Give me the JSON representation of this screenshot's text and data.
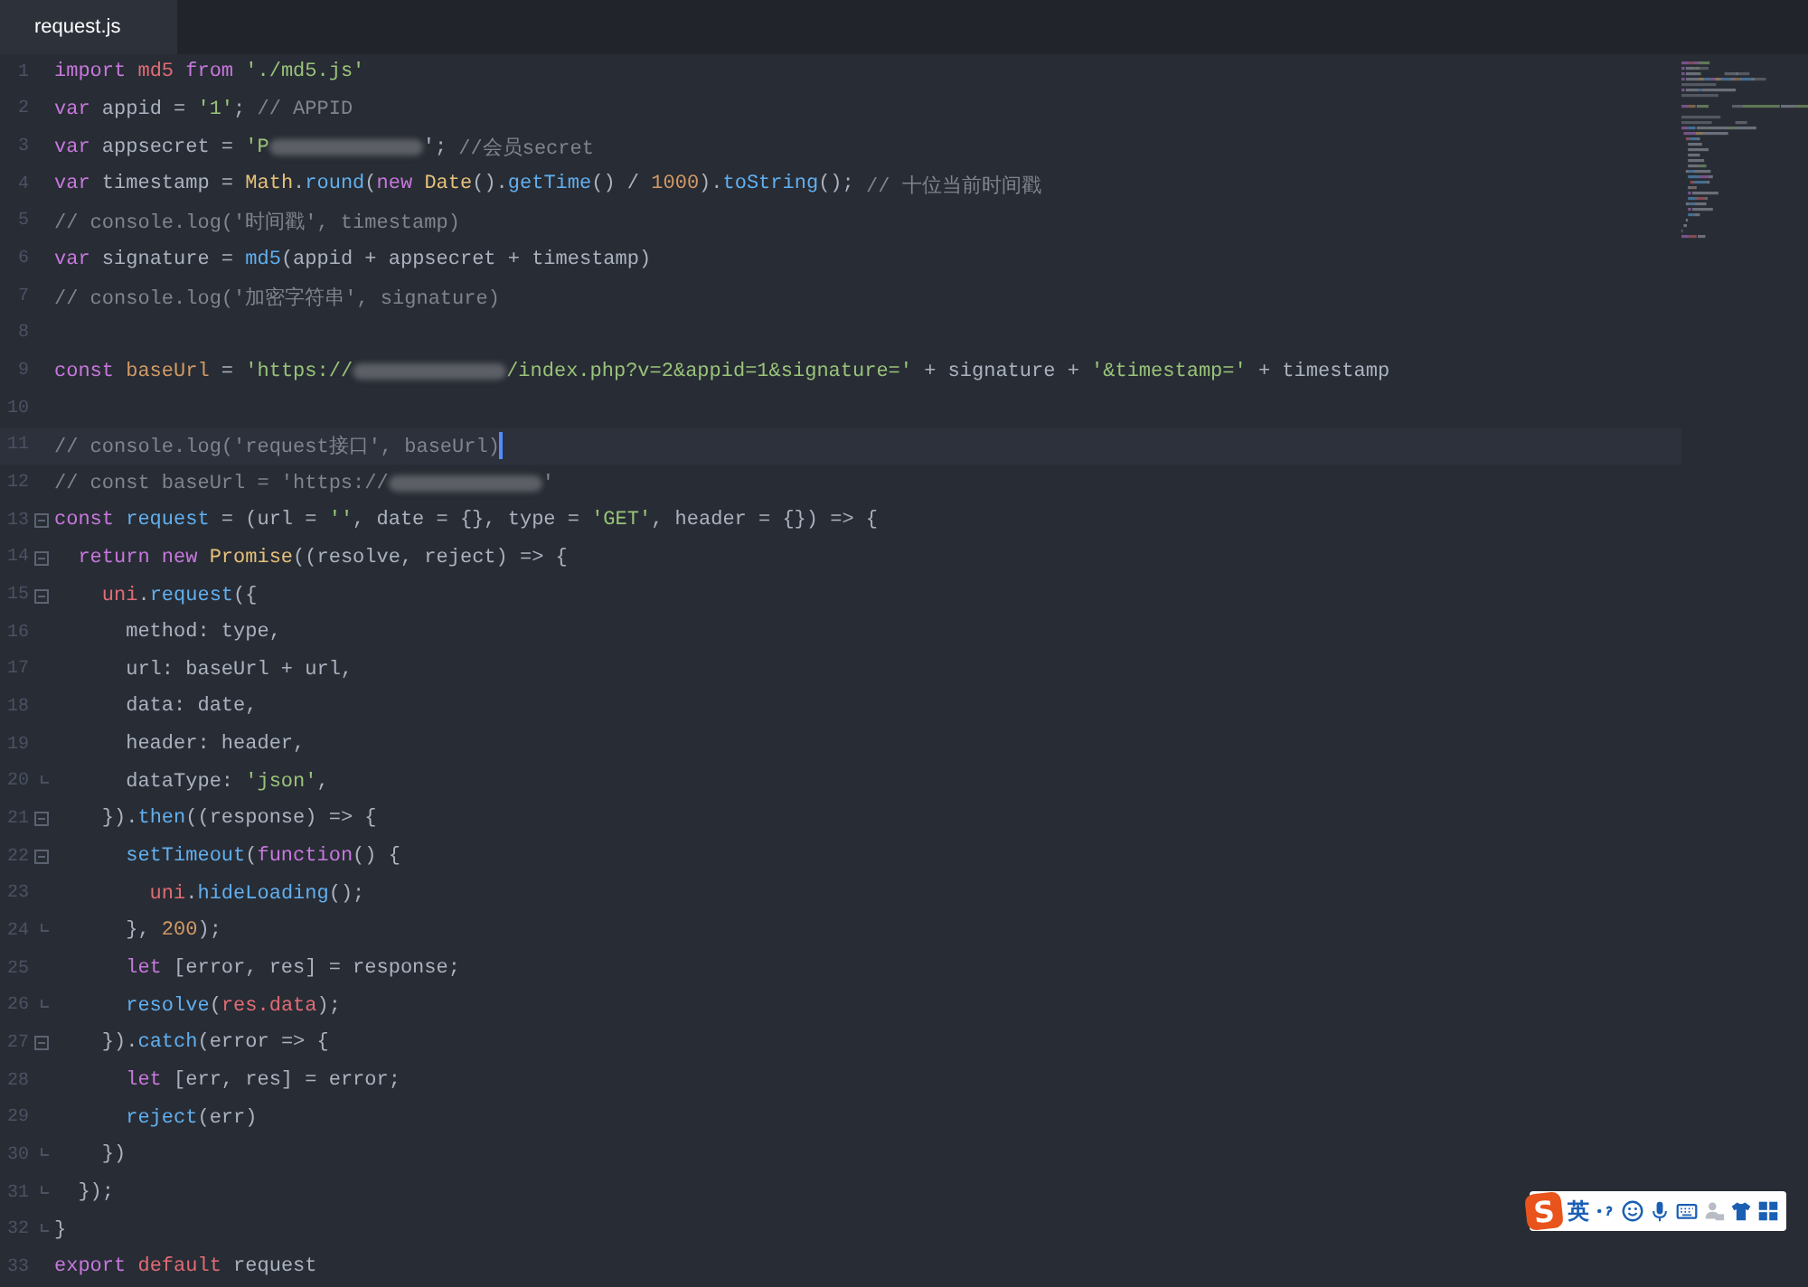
{
  "tabs": [
    {
      "label": "request.js",
      "selected": true
    }
  ],
  "lines": [
    {
      "number": "1",
      "tokens": [
        {
          "kind": "kw",
          "text": "import "
        },
        {
          "kind": "var",
          "text": "md5 "
        },
        {
          "kind": "kw",
          "text": "from "
        },
        {
          "kind": "str",
          "text": "'./md5.js'"
        }
      ]
    },
    {
      "number": "2",
      "tokens": [
        {
          "kind": "kw",
          "text": "var"
        },
        {
          "kind": "p",
          "text": " appid = "
        },
        {
          "kind": "str",
          "text": "'1'"
        },
        {
          "kind": "p",
          "text": "; "
        },
        {
          "kind": "cmt",
          "text": "// APPID"
        }
      ]
    },
    {
      "number": "3",
      "tokens": [
        {
          "kind": "kw",
          "text": "var"
        },
        {
          "kind": "p",
          "text": " appsecret = "
        },
        {
          "kind": "str",
          "text": "'P"
        },
        {
          "kind": "redacted"
        },
        {
          "kind": "p",
          "text": "'; "
        },
        {
          "kind": "cmt",
          "text": "//会员secret"
        }
      ]
    },
    {
      "number": "4",
      "tokens": [
        {
          "kind": "kw",
          "text": "var"
        },
        {
          "kind": "p",
          "text": " timestamp = "
        },
        {
          "kind": "cls",
          "text": "Math"
        },
        {
          "kind": "p",
          "text": "."
        },
        {
          "kind": "fn",
          "text": "round"
        },
        {
          "kind": "p",
          "text": "("
        },
        {
          "kind": "kw",
          "text": "new "
        },
        {
          "kind": "cls",
          "text": "Date"
        },
        {
          "kind": "p",
          "text": "()."
        },
        {
          "kind": "fn",
          "text": "getTime"
        },
        {
          "kind": "p",
          "text": "() / "
        },
        {
          "kind": "num",
          "text": "1000"
        },
        {
          "kind": "p",
          "text": ")."
        },
        {
          "kind": "fn",
          "text": "toString"
        },
        {
          "kind": "p",
          "text": "(); "
        },
        {
          "kind": "cmt",
          "text": "// 十位当前时间戳"
        }
      ]
    },
    {
      "number": "5",
      "tokens": [
        {
          "kind": "cmt",
          "text": "// console.log('时间戳', timestamp)"
        }
      ]
    },
    {
      "number": "6",
      "tokens": [
        {
          "kind": "kw",
          "text": "var"
        },
        {
          "kind": "p",
          "text": " signature = "
        },
        {
          "kind": "fn",
          "text": "md5"
        },
        {
          "kind": "p",
          "text": "(appid + appsecret + timestamp)"
        }
      ]
    },
    {
      "number": "7",
      "tokens": [
        {
          "kind": "cmt",
          "text": "// console.log('加密字符串', signature)"
        }
      ]
    },
    {
      "number": "8"
    },
    {
      "number": "9",
      "tokens": [
        {
          "kind": "kw",
          "text": "const "
        },
        {
          "kind": "prop",
          "text": "baseUrl"
        },
        {
          "kind": "p",
          "text": " = "
        },
        {
          "kind": "str",
          "text": "'https://"
        },
        {
          "kind": "redacted"
        },
        {
          "kind": "str",
          "text": "/index.php?v=2&appid=1&signature='"
        },
        {
          "kind": "p",
          "text": " + signature + "
        },
        {
          "kind": "str",
          "text": "'&timestamp='"
        },
        {
          "kind": "p",
          "text": " + timestamp"
        }
      ]
    },
    {
      "number": "10"
    },
    {
      "number": "11",
      "current": true,
      "tokens": [
        {
          "kind": "cmt",
          "text": "// console.log('request接口', baseUrl)"
        }
      ]
    },
    {
      "number": "12",
      "tokens": [
        {
          "kind": "cmt",
          "text": "// const baseUrl = 'https://"
        },
        {
          "kind": "redacted"
        },
        {
          "kind": "cmt",
          "text": "'"
        }
      ]
    },
    {
      "number": "13",
      "expanded": true,
      "tokens": [
        {
          "kind": "kw",
          "text": "const "
        },
        {
          "kind": "fn",
          "text": "request"
        },
        {
          "kind": "p",
          "text": " = (url = "
        },
        {
          "kind": "str",
          "text": "''"
        },
        {
          "kind": "p",
          "text": ", date = {}, type = "
        },
        {
          "kind": "str",
          "text": "'GET'"
        },
        {
          "kind": "p",
          "text": ", header = {}) => {"
        }
      ]
    },
    {
      "number": "14",
      "expanded": true,
      "tokens": [
        {
          "kind": "kw",
          "text": "  return new "
        },
        {
          "kind": "cls",
          "text": "Promise"
        },
        {
          "kind": "p",
          "text": "((resolve, reject) => {"
        }
      ]
    },
    {
      "number": "15",
      "expanded": true,
      "tokens": [
        {
          "kind": "var",
          "text": "    uni"
        },
        {
          "kind": "p",
          "text": "."
        },
        {
          "kind": "fn",
          "text": "request"
        },
        {
          "kind": "p",
          "text": "({"
        }
      ]
    },
    {
      "number": "16",
      "tokens": [
        {
          "kind": "p",
          "text": "      method: type,"
        }
      ]
    },
    {
      "number": "17",
      "tokens": [
        {
          "kind": "p",
          "text": "      url: baseUrl + url,"
        }
      ]
    },
    {
      "number": "18",
      "tokens": [
        {
          "kind": "p",
          "text": "      data: date,"
        }
      ]
    },
    {
      "number": "19",
      "tokens": [
        {
          "kind": "p",
          "text": "      header: header,"
        }
      ]
    },
    {
      "number": "20",
      "block_end": true,
      "tokens": [
        {
          "kind": "p",
          "text": "      dataType: "
        },
        {
          "kind": "str",
          "text": "'json'"
        },
        {
          "kind": "p",
          "text": ","
        }
      ]
    },
    {
      "number": "21",
      "expanded": true,
      "tokens": [
        {
          "kind": "p",
          "text": "    })."
        },
        {
          "kind": "fn",
          "text": "then"
        },
        {
          "kind": "p",
          "text": "((response) => {"
        }
      ]
    },
    {
      "number": "22",
      "expanded": true,
      "tokens": [
        {
          "kind": "fn",
          "text": "      setTimeout"
        },
        {
          "kind": "p",
          "text": "("
        },
        {
          "kind": "kw",
          "text": "function"
        },
        {
          "kind": "p",
          "text": "() {"
        }
      ]
    },
    {
      "number": "23",
      "tokens": [
        {
          "kind": "var",
          "text": "        uni"
        },
        {
          "kind": "p",
          "text": "."
        },
        {
          "kind": "fn",
          "text": "hideLoading"
        },
        {
          "kind": "p",
          "text": "();"
        }
      ]
    },
    {
      "number": "24",
      "block_end": true,
      "tokens": [
        {
          "kind": "p",
          "text": "      }, "
        },
        {
          "kind": "num",
          "text": "200"
        },
        {
          "kind": "p",
          "text": ");"
        }
      ]
    },
    {
      "number": "25",
      "tokens": [
        {
          "kind": "kw",
          "text": "      let"
        },
        {
          "kind": "p",
          "text": " [error, res] = response;"
        }
      ]
    },
    {
      "number": "26",
      "block_end": true,
      "tokens": [
        {
          "kind": "fn",
          "text": "      resolve"
        },
        {
          "kind": "p",
          "text": "("
        },
        {
          "kind": "var",
          "text": "res.data"
        },
        {
          "kind": "p",
          "text": ");"
        }
      ]
    },
    {
      "number": "27",
      "expanded": true,
      "tokens": [
        {
          "kind": "p",
          "text": "    })."
        },
        {
          "kind": "fn",
          "text": "catch"
        },
        {
          "kind": "p",
          "text": "(error => {"
        }
      ]
    },
    {
      "number": "28",
      "tokens": [
        {
          "kind": "kw",
          "text": "      let"
        },
        {
          "kind": "p",
          "text": " [err, res] = error;"
        }
      ]
    },
    {
      "number": "29",
      "tokens": [
        {
          "kind": "fn",
          "text": "      reject"
        },
        {
          "kind": "p",
          "text": "(err)"
        }
      ]
    },
    {
      "number": "30",
      "block_end": true,
      "tokens": [
        {
          "kind": "p",
          "text": "    })"
        }
      ]
    },
    {
      "number": "31",
      "block_end": true,
      "tokens": [
        {
          "kind": "p",
          "text": "  });"
        }
      ]
    },
    {
      "number": "32",
      "block_end": true,
      "tokens": [
        {
          "kind": "p",
          "text": "}"
        }
      ]
    },
    {
      "number": "33",
      "tokens": [
        {
          "kind": "kw",
          "text": "export "
        },
        {
          "kind": "var",
          "text": "default"
        },
        {
          "kind": "p",
          "text": " request"
        }
      ]
    }
  ],
  "ime_toolbar": {
    "logo": "S",
    "mode": "英"
  }
}
